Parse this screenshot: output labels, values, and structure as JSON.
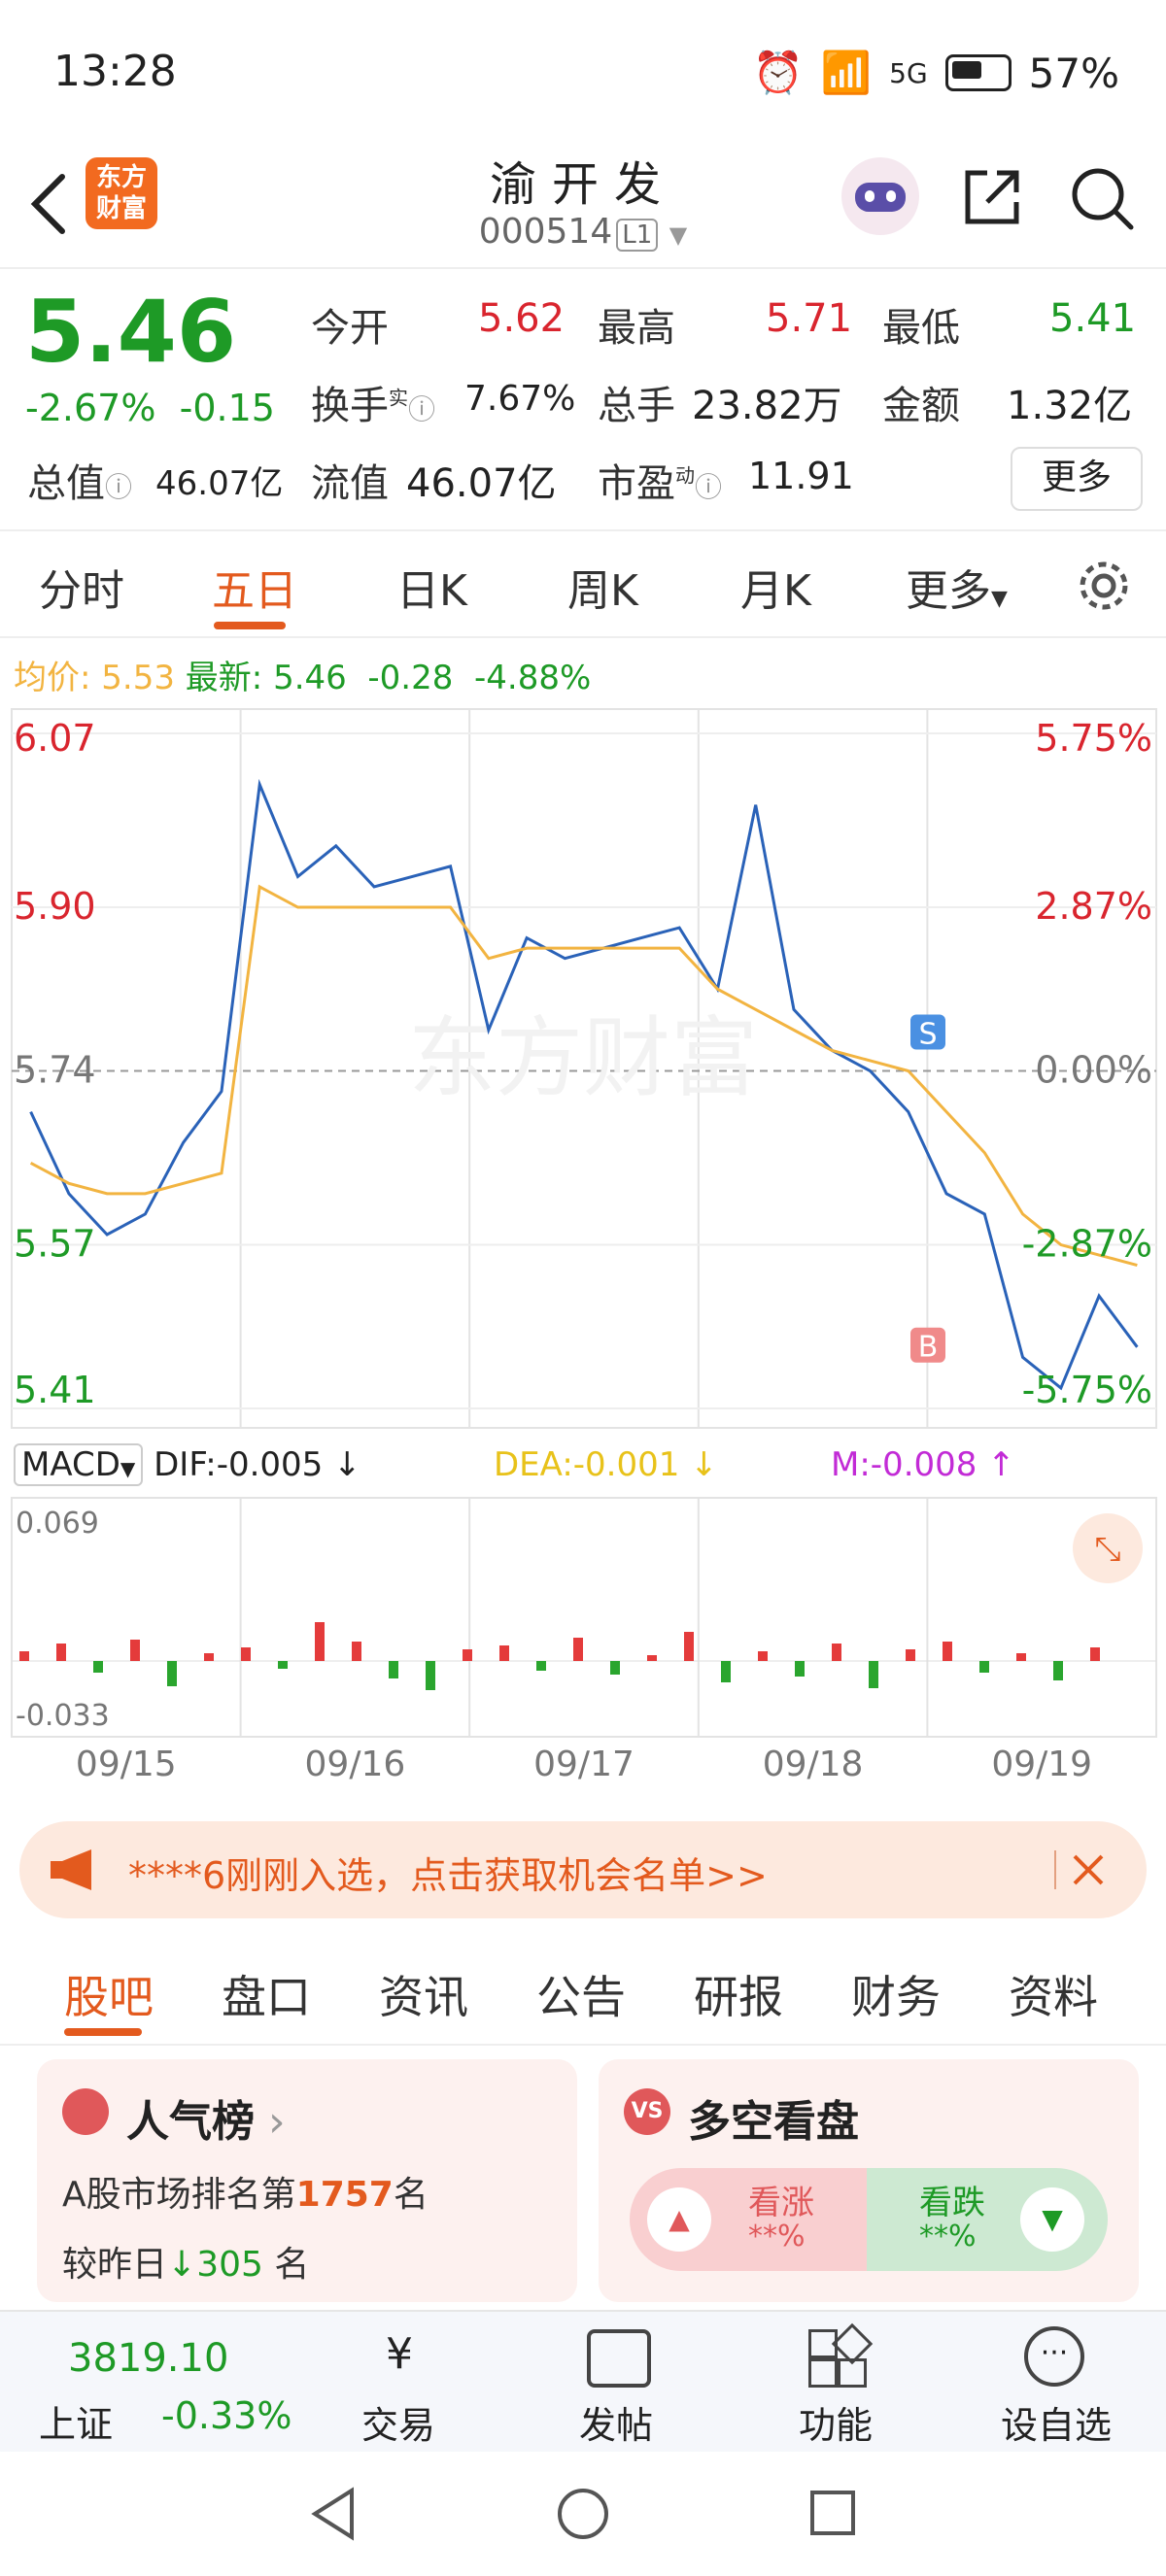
{
  "status": {
    "time": "13:28",
    "battery": "57%",
    "network": "5G"
  },
  "header": {
    "logo_line1": "东方",
    "logo_line2": "财富",
    "name": "渝开发",
    "code": "000514",
    "level": "L1"
  },
  "quote": {
    "price": "5.46",
    "change_pct": "-2.67%",
    "change": "-0.15",
    "open_label": "今开",
    "open": "5.62",
    "high_label": "最高",
    "high": "5.71",
    "low_label": "最低",
    "low": "5.41",
    "turnover_label": "换手",
    "turnover_sup": "实",
    "turnover": "7.67%",
    "volume_label": "总手",
    "volume": "23.82万",
    "amount_label": "金额",
    "amount": "1.32亿",
    "mktcap_label": "总值",
    "mktcap": "46.07亿",
    "float_label": "流值",
    "float": "46.07亿",
    "pe_label": "市盈",
    "pe_sup": "动",
    "pe": "11.91",
    "more": "更多"
  },
  "tabs": [
    "分时",
    "五日",
    "日K",
    "周K",
    "月K",
    "更多"
  ],
  "info_line": {
    "avg_label": "均价:",
    "avg": "5.53",
    "latest_label": "最新:",
    "latest": "5.46",
    "chg": "-0.28",
    "pct": "-4.88%"
  },
  "chart_data": {
    "type": "line",
    "x_labels": [
      "09/15",
      "09/16",
      "09/17",
      "09/18",
      "09/19"
    ],
    "y_ticks_left": [
      "6.07",
      "5.90",
      "5.74",
      "5.57",
      "5.41"
    ],
    "y_ticks_right": [
      "5.75%",
      "2.87%",
      "0.00%",
      "-2.87%",
      "-5.75%"
    ],
    "ylim": [
      5.41,
      6.07
    ],
    "watermark": "东方财富",
    "series": [
      {
        "name": "price",
        "color": "#2a62b8",
        "values": [
          5.7,
          5.62,
          5.58,
          5.6,
          5.67,
          5.72,
          6.02,
          5.93,
          5.96,
          5.92,
          5.93,
          5.94,
          5.78,
          5.87,
          5.85,
          5.86,
          5.87,
          5.88,
          5.82,
          6.0,
          5.8,
          5.76,
          5.74,
          5.7,
          5.62,
          5.6,
          5.46,
          5.43,
          5.52,
          5.47
        ]
      },
      {
        "name": "avg",
        "color": "#f2b441",
        "values": [
          5.65,
          5.63,
          5.62,
          5.62,
          5.63,
          5.64,
          5.92,
          5.9,
          5.9,
          5.9,
          5.9,
          5.9,
          5.85,
          5.86,
          5.86,
          5.86,
          5.86,
          5.86,
          5.82,
          5.8,
          5.78,
          5.76,
          5.75,
          5.74,
          5.7,
          5.66,
          5.6,
          5.57,
          5.56,
          5.55
        ]
      }
    ],
    "markers": [
      {
        "label": "S",
        "value": 5.74
      },
      {
        "label": "B",
        "value": 5.51
      }
    ]
  },
  "macd": {
    "label": "MACD",
    "dif": "DIF:-0.005",
    "dea": "DEA:-0.001",
    "m": "M:-0.008",
    "top": "0.069",
    "bottom": "-0.033"
  },
  "banner": {
    "text": "****6刚刚入选，点击获取机会名单>>"
  },
  "tabs2": [
    "股吧",
    "盘口",
    "资讯",
    "公告",
    "研报",
    "财务",
    "资料"
  ],
  "popularity": {
    "title": "人气榜",
    "rank_prefix": "A股市场排名第",
    "rank": "1757",
    "rank_suffix": "名",
    "cmp_prefix": "较昨日",
    "cmp": "305",
    "cmp_suffix": "名"
  },
  "vs": {
    "title": "多空看盘",
    "up": "看涨",
    "up_val": "**%",
    "down": "看跌",
    "down_val": "**%"
  },
  "bottom": {
    "index_val": "3819.10",
    "index_name": "上证",
    "index_pct": "-0.33%",
    "trade": "交易",
    "post": "发帖",
    "func": "功能",
    "watch": "设自选"
  }
}
